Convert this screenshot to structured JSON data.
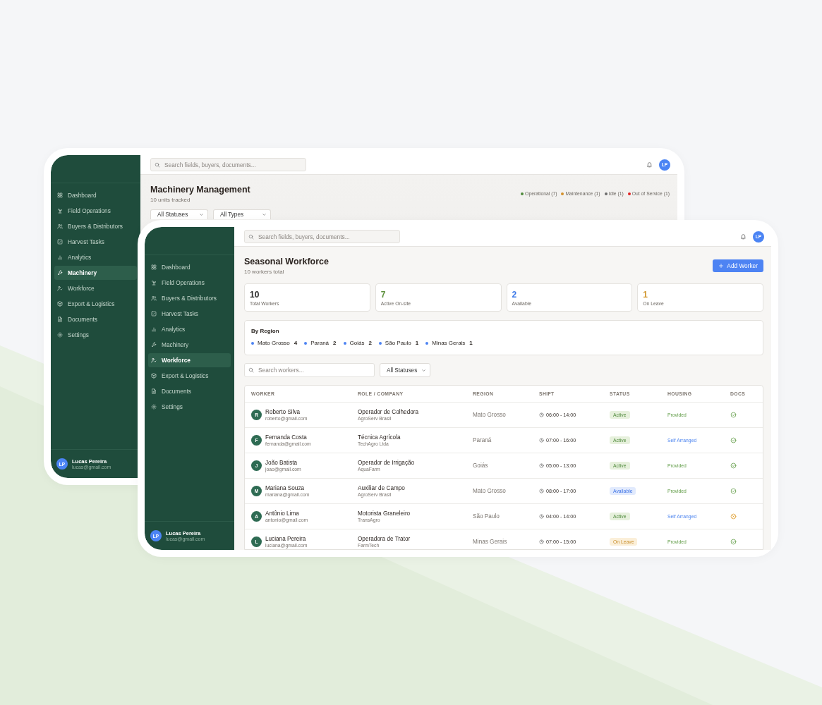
{
  "back_window": {
    "sidebar": {
      "items": [
        {
          "label": "Dashboard",
          "selected": false
        },
        {
          "label": "Field Operations",
          "selected": false
        },
        {
          "label": "Buyers & Distributors",
          "selected": false
        },
        {
          "label": "Harvest Tasks",
          "selected": false
        },
        {
          "label": "Analytics",
          "selected": false
        },
        {
          "label": "Machinery",
          "selected": true
        },
        {
          "label": "Workforce",
          "selected": false
        },
        {
          "label": "Export & Logistics",
          "selected": false
        },
        {
          "label": "Documents",
          "selected": false
        },
        {
          "label": "Settings",
          "selected": false
        }
      ],
      "user": {
        "initials": "LP",
        "name": "Lucas Pereira",
        "email": "lucas@gmail.com"
      }
    },
    "topbar": {
      "search_placeholder": "Search fields, buyers, documents...",
      "avatar": "LP"
    },
    "page": {
      "title": "Machinery Management",
      "subtitle": "10 units tracked",
      "legend": [
        {
          "label": "Operational (7)",
          "color": "#4f8a3c"
        },
        {
          "label": "Maintenance (1)",
          "color": "#d4912b"
        },
        {
          "label": "Idle (1)",
          "color": "#6b6b6b"
        },
        {
          "label": "Out of Service (1)",
          "color": "#e02424"
        }
      ],
      "filters": [
        "All Statuses",
        "All Types"
      ]
    }
  },
  "front_window": {
    "sidebar": {
      "items": [
        {
          "label": "Dashboard",
          "selected": false
        },
        {
          "label": "Field Operations",
          "selected": false
        },
        {
          "label": "Buyers & Distributors",
          "selected": false
        },
        {
          "label": "Harvest Tasks",
          "selected": false
        },
        {
          "label": "Analytics",
          "selected": false
        },
        {
          "label": "Machinery",
          "selected": false
        },
        {
          "label": "Workforce",
          "selected": true
        },
        {
          "label": "Export & Logistics",
          "selected": false
        },
        {
          "label": "Documents",
          "selected": false
        },
        {
          "label": "Settings",
          "selected": false
        }
      ],
      "user": {
        "initials": "LP",
        "name": "Lucas Pereira",
        "email": "lucas@gmail.com"
      }
    },
    "topbar": {
      "search_placeholder": "Search fields, buyers, documents...",
      "avatar": "LP"
    },
    "page": {
      "title": "Seasonal Workforce",
      "subtitle": "10 workers total",
      "add_button": "Add Worker",
      "stats": [
        {
          "value": "10",
          "label": "Total Workers",
          "color": "#2b2b2b"
        },
        {
          "value": "7",
          "label": "Active On-site",
          "color": "#5b8f3a"
        },
        {
          "value": "2",
          "label": "Available",
          "color": "#3f7be8"
        },
        {
          "value": "1",
          "label": "On Leave",
          "color": "#d1972e"
        }
      ],
      "region": {
        "title": "By Region",
        "items": [
          {
            "name": "Mato Grosso",
            "count": "4"
          },
          {
            "name": "Paraná",
            "count": "2"
          },
          {
            "name": "Goiás",
            "count": "2"
          },
          {
            "name": "São Paulo",
            "count": "1"
          },
          {
            "name": "Minas Gerais",
            "count": "1"
          }
        ]
      },
      "search_placeholder": "Search workers...",
      "status_filter": "All Statuses",
      "table": {
        "columns": [
          "WORKER",
          "ROLE / COMPANY",
          "REGION",
          "SHIFT",
          "STATUS",
          "HOUSING",
          "DOCS"
        ],
        "rows": [
          {
            "avatar": "R",
            "name": "Roberto Silva",
            "email": "roberto@gmail.com",
            "role": "Operador de Colhedora",
            "company": "AgroServ Brasil",
            "region": "Mato Grosso",
            "shift": "06:00 - 14:00",
            "status": {
              "label": "Active",
              "kind": "active"
            },
            "housing": {
              "label": "Provided",
              "kind": "provided"
            },
            "docs_complete": true
          },
          {
            "avatar": "F",
            "name": "Fernanda Costa",
            "email": "fernanda@gmail.com",
            "role": "Técnica Agrícola",
            "company": "TechAgro Ltda",
            "region": "Paraná",
            "shift": "07:00 - 16:00",
            "status": {
              "label": "Active",
              "kind": "active"
            },
            "housing": {
              "label": "Self Arranged",
              "kind": "self"
            },
            "docs_complete": true
          },
          {
            "avatar": "J",
            "name": "João Batista",
            "email": "joao@gmail.com",
            "role": "Operador de Irrigação",
            "company": "AquaFarm",
            "region": "Goiás",
            "shift": "05:00 - 13:00",
            "status": {
              "label": "Active",
              "kind": "active"
            },
            "housing": {
              "label": "Provided",
              "kind": "provided"
            },
            "docs_complete": true
          },
          {
            "avatar": "M",
            "name": "Mariana Souza",
            "email": "mariana@gmail.com",
            "role": "Auxiliar de Campo",
            "company": "AgroServ Brasil",
            "region": "Mato Grosso",
            "shift": "08:00 - 17:00",
            "status": {
              "label": "Available",
              "kind": "available"
            },
            "housing": {
              "label": "Provided",
              "kind": "provided"
            },
            "docs_complete": true
          },
          {
            "avatar": "A",
            "name": "Antônio Lima",
            "email": "antonio@gmail.com",
            "role": "Motorista Graneleiro",
            "company": "TransAgro",
            "region": "São Paulo",
            "shift": "04:00 - 14:00",
            "status": {
              "label": "Active",
              "kind": "active"
            },
            "housing": {
              "label": "Self Arranged",
              "kind": "self"
            },
            "docs_complete": false
          },
          {
            "avatar": "L",
            "name": "Luciana Pereira",
            "email": "luciana@gmail.com",
            "role": "Operadora de Trator",
            "company": "FarmTech",
            "region": "Minas Gerais",
            "shift": "07:00 - 15:00",
            "status": {
              "label": "On Leave",
              "kind": "leave"
            },
            "housing": {
              "label": "Provided",
              "kind": "provided"
            },
            "docs_complete": true
          }
        ]
      }
    }
  }
}
